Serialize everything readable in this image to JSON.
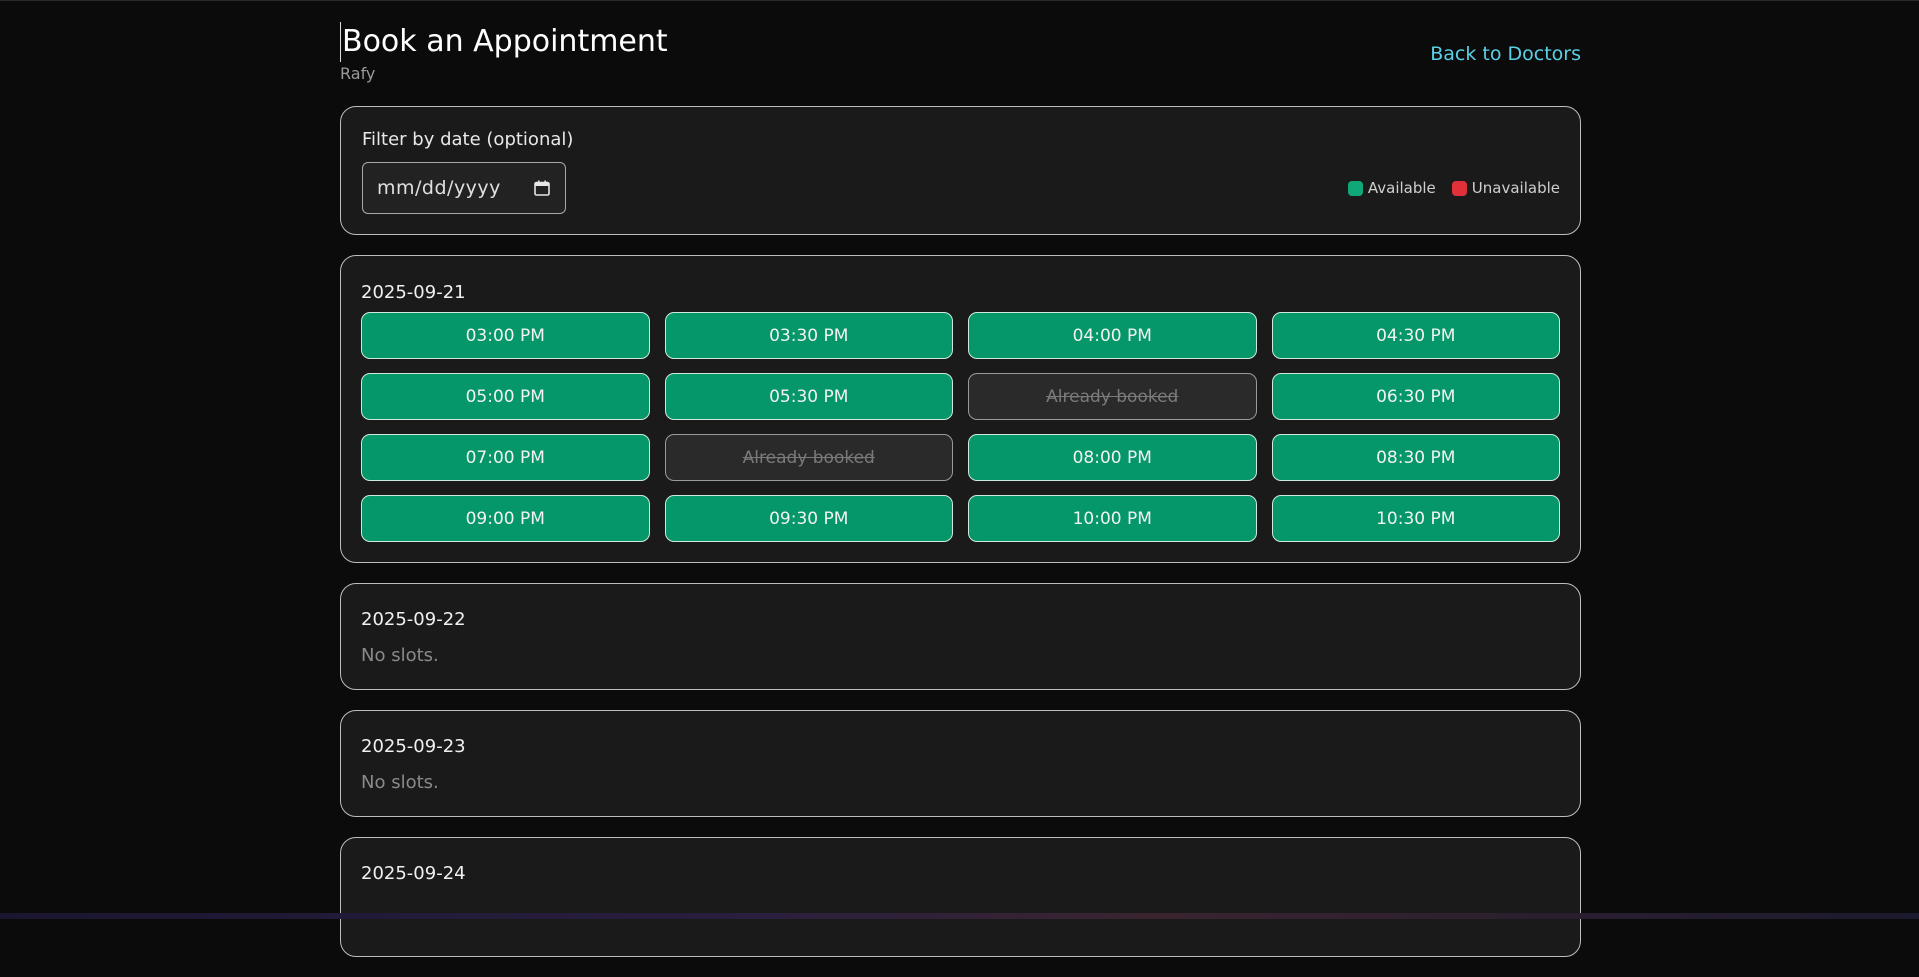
{
  "header": {
    "title": "Book an Appointment",
    "doctor_name": "Rafy",
    "back_link": "Back to Doctors"
  },
  "filter": {
    "label": "Filter by date (optional)",
    "date_placeholder": "mm/dd/yyyy",
    "legend": [
      {
        "label": "Available",
        "color": "#10a878"
      },
      {
        "label": "Unavailable",
        "color": "#e0303a"
      }
    ]
  },
  "days": [
    {
      "date": "2025-09-21",
      "slots": [
        {
          "label": "03:00 PM",
          "booked": false
        },
        {
          "label": "03:30 PM",
          "booked": false
        },
        {
          "label": "04:00 PM",
          "booked": false
        },
        {
          "label": "04:30 PM",
          "booked": false
        },
        {
          "label": "05:00 PM",
          "booked": false
        },
        {
          "label": "05:30 PM",
          "booked": false
        },
        {
          "label": "Already booked",
          "booked": true
        },
        {
          "label": "06:30 PM",
          "booked": false
        },
        {
          "label": "07:00 PM",
          "booked": false
        },
        {
          "label": "Already booked",
          "booked": true
        },
        {
          "label": "08:00 PM",
          "booked": false
        },
        {
          "label": "08:30 PM",
          "booked": false
        },
        {
          "label": "09:00 PM",
          "booked": false
        },
        {
          "label": "09:30 PM",
          "booked": false
        },
        {
          "label": "10:00 PM",
          "booked": false
        },
        {
          "label": "10:30 PM",
          "booked": false
        }
      ]
    },
    {
      "date": "2025-09-22",
      "empty_text": "No slots."
    },
    {
      "date": "2025-09-23",
      "empty_text": "No slots."
    },
    {
      "date": "2025-09-24"
    }
  ]
}
